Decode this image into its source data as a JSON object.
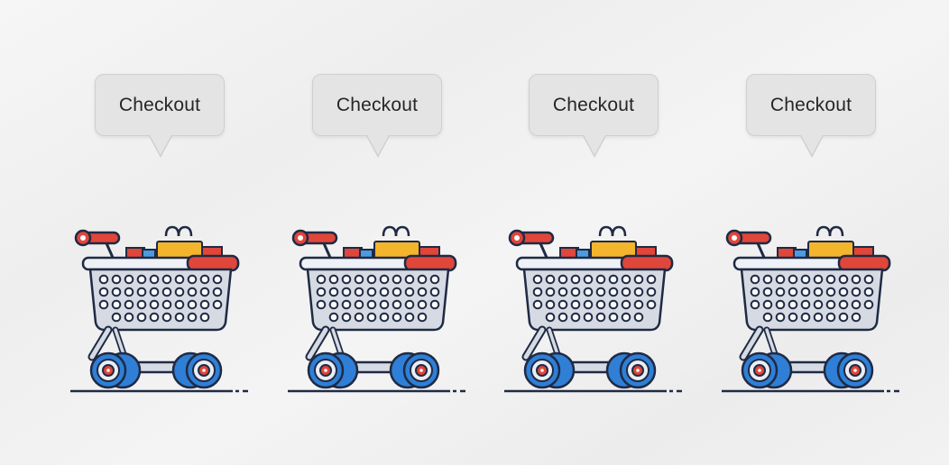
{
  "checkout_items": [
    {
      "label": "Checkout",
      "icon": "shopping-cart-icon"
    },
    {
      "label": "Checkout",
      "icon": "shopping-cart-icon"
    },
    {
      "label": "Checkout",
      "icon": "shopping-cart-icon"
    },
    {
      "label": "Checkout",
      "icon": "shopping-cart-icon"
    }
  ],
  "colors": {
    "bubble_fill": "#e4e4e4",
    "bubble_border": "#cfcfcf",
    "cart_body": "#d6dbe3",
    "cart_outline": "#1f2a44",
    "wheel_blue": "#2f7fd6",
    "hub_red": "#e0463a",
    "bag_yellow": "#f3b52c"
  }
}
